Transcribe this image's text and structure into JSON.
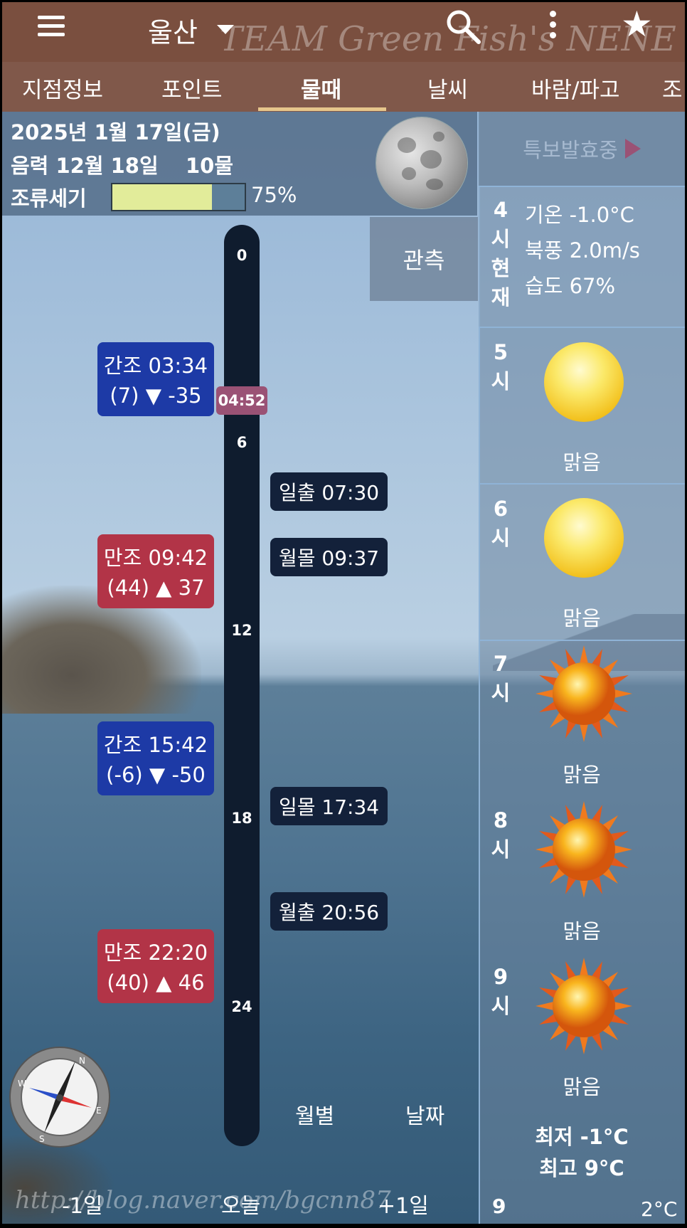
{
  "header": {
    "city": "울산",
    "watermark": "TEAM Green Fish's NENE"
  },
  "tabs": [
    "지점정보",
    "포인트",
    "물때",
    "날씨",
    "바람/파고",
    "조"
  ],
  "active_tab": "물때",
  "info": {
    "date": "2025년 1월 17일(금)",
    "lunar": "음력 12월 18일",
    "tide_age": "10물",
    "current_label": "조류세기",
    "current_percent": "75%",
    "current_fraction": 0.75
  },
  "observe_label": "관측",
  "timeline": {
    "ticks": [
      "0",
      "6",
      "12",
      "18",
      "24"
    ],
    "now": "04:52"
  },
  "tides": [
    {
      "line1": "간조 03:34",
      "line2": "(7) ▼ -35",
      "kind": "ebb"
    },
    {
      "line1": "만조 09:42",
      "line2": "(44) ▲ 37",
      "kind": "flood"
    },
    {
      "line1": "간조 15:42",
      "line2": "(-6) ▼ -50",
      "kind": "ebb"
    },
    {
      "line1": "만조 22:20",
      "line2": "(40) ▲ 46",
      "kind": "flood"
    }
  ],
  "events": [
    "일출 07:30",
    "월몰 09:37",
    "일몰 17:34",
    "월출 20:56"
  ],
  "bottom": {
    "monthly": "월별",
    "date": "날짜",
    "prev": "-1일",
    "today": "오늘",
    "next": "+1일",
    "url_watermark": "http://blog.naver.com/bgcnn87"
  },
  "weather": {
    "warning": "특보발효중",
    "current": {
      "hour_chars": [
        "4",
        "시",
        "현",
        "재"
      ],
      "temp": "기온 -1.0°C",
      "wind": "북풍 2.0m/s",
      "humidity": "습도 67%"
    },
    "hours": [
      {
        "hour": "5",
        "unit": "시",
        "cond": "맑음",
        "icon": "sun-icon"
      },
      {
        "hour": "6",
        "unit": "시",
        "cond": "맑음",
        "icon": "sun-icon"
      },
      {
        "hour": "7",
        "unit": "시",
        "cond": "맑음",
        "icon": "sunburst-icon"
      },
      {
        "hour": "8",
        "unit": "시",
        "cond": "맑음",
        "icon": "sunburst-icon"
      },
      {
        "hour": "9",
        "unit": "시",
        "cond": "맑음",
        "icon": "sunburst-icon"
      }
    ],
    "min": "최저 -1°C",
    "max": "최고 9°C",
    "next_hour": "9",
    "next_temp": "2°C"
  }
}
